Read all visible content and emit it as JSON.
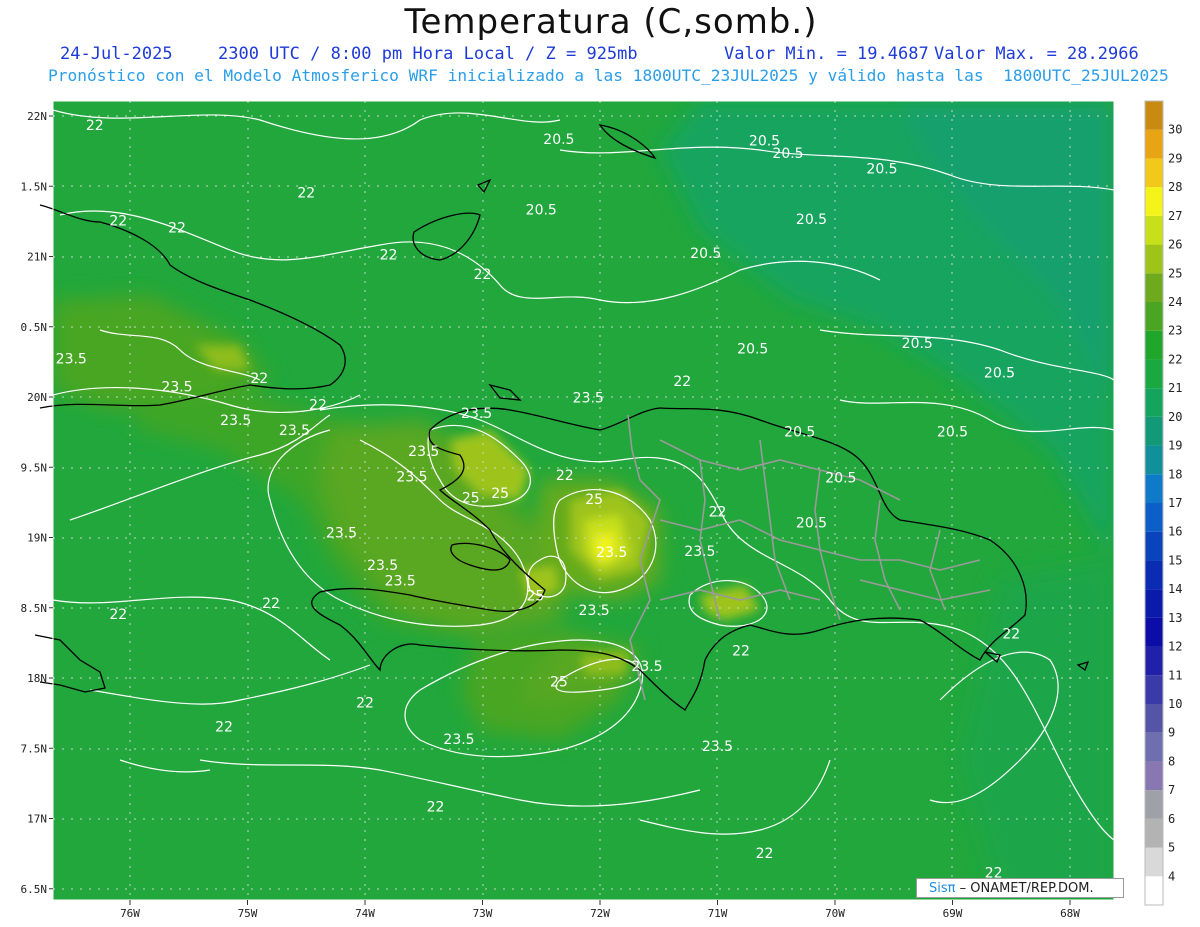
{
  "title": "Temperatura (C,somb.)",
  "subtitle": {
    "date": "24-Jul-2025",
    "time": "2300 UTC / 8:00 pm Hora Local / Z = 925mb",
    "min": "Valor Min. = 19.4687",
    "max": "Valor Max. = 28.2966"
  },
  "forecast_note": "Pronóstico con el Modelo Atmosferico WRF inicializado a las 1800UTC_23JUL2025 y válido hasta las  1800UTC_25JUL2025",
  "credit": {
    "brand": "Sisπ",
    "org": " – ONAMET/REP.DOM."
  },
  "chart_data": {
    "type": "heatmap",
    "variable": "Temperatura (C,somb.)",
    "level": "925mb",
    "value_min": 19.4687,
    "value_max": 28.2966,
    "x_ticks": [
      "76W",
      "75W",
      "74W",
      "73W",
      "72W",
      "71W",
      "70W",
      "69W",
      "68W"
    ],
    "y_ticks": [
      "22N",
      "1.5N",
      "21N",
      "0.5N",
      "20N",
      "9.5N",
      "19N",
      "8.5N",
      "18N",
      "7.5N",
      "17N",
      "6.5N"
    ],
    "colorbar_levels": [
      4,
      5,
      6,
      7,
      8,
      9,
      10,
      11,
      12,
      13,
      14,
      15,
      16,
      17,
      18,
      19,
      20,
      21,
      22,
      23,
      24,
      25,
      26,
      27,
      28,
      29,
      30
    ],
    "colorbar_colors": [
      "#ffffff",
      "#d9d9d9",
      "#b3b3b3",
      "#a0a0a8",
      "#8877b0",
      "#6f6fb0",
      "#5555a8",
      "#3a3aa8",
      "#2020a8",
      "#0c0ca6",
      "#0a1aaa",
      "#0a2cb2",
      "#0a44bc",
      "#0c5ec8",
      "#0f7ac8",
      "#10909a",
      "#129a78",
      "#15a45e",
      "#1aa840",
      "#20a62a",
      "#4aa622",
      "#6faa1e",
      "#9ec41a",
      "#c8e01a",
      "#f4f41a",
      "#f2c81a",
      "#e8a414",
      "#c88a10"
    ],
    "contour_levels": [
      20.5,
      22,
      23.5,
      25
    ],
    "contour_labels": [
      {
        "text": "20.5",
        "lon": -72.35,
        "lat": 21.8
      },
      {
        "text": "20.5",
        "lon": -70.6,
        "lat": 21.79
      },
      {
        "text": "20.5",
        "lon": -70.4,
        "lat": 21.7
      },
      {
        "text": "20.5",
        "lon": -69.6,
        "lat": 21.59
      },
      {
        "text": "20.5",
        "lon": -72.5,
        "lat": 21.3
      },
      {
        "text": "20.5",
        "lon": -70.2,
        "lat": 21.23
      },
      {
        "text": "20.5",
        "lon": -71.1,
        "lat": 20.99
      },
      {
        "text": "20.5",
        "lon": -70.7,
        "lat": 20.31
      },
      {
        "text": "20.5",
        "lon": -69.3,
        "lat": 20.35
      },
      {
        "text": "20.5",
        "lon": -68.6,
        "lat": 20.14
      },
      {
        "text": "20.5",
        "lon": -70.3,
        "lat": 19.72
      },
      {
        "text": "20.5",
        "lon": -69.0,
        "lat": 19.72
      },
      {
        "text": "20.5",
        "lon": -69.95,
        "lat": 19.39
      },
      {
        "text": "20.5",
        "lon": -70.2,
        "lat": 19.07
      },
      {
        "text": "22",
        "lon": -76.3,
        "lat": 21.9
      },
      {
        "text": "22",
        "lon": -76.1,
        "lat": 21.22
      },
      {
        "text": "22",
        "lon": -74.5,
        "lat": 21.42
      },
      {
        "text": "22",
        "lon": -75.6,
        "lat": 21.17
      },
      {
        "text": "22",
        "lon": -73.8,
        "lat": 20.98
      },
      {
        "text": "22",
        "lon": -73.0,
        "lat": 20.84
      },
      {
        "text": "22",
        "lon": -74.9,
        "lat": 20.1
      },
      {
        "text": "22",
        "lon": -74.4,
        "lat": 19.91
      },
      {
        "text": "22",
        "lon": -71.3,
        "lat": 20.08
      },
      {
        "text": "22",
        "lon": -72.3,
        "lat": 19.41
      },
      {
        "text": "22",
        "lon": -71.0,
        "lat": 19.15
      },
      {
        "text": "22",
        "lon": -70.8,
        "lat": 18.16
      },
      {
        "text": "22",
        "lon": -68.5,
        "lat": 18.28
      },
      {
        "text": "22",
        "lon": -76.1,
        "lat": 18.42
      },
      {
        "text": "22",
        "lon": -74.8,
        "lat": 18.5
      },
      {
        "text": "22",
        "lon": -74.0,
        "lat": 17.79
      },
      {
        "text": "22",
        "lon": -75.2,
        "lat": 17.62
      },
      {
        "text": "22",
        "lon": -73.4,
        "lat": 17.05
      },
      {
        "text": "22",
        "lon": -70.6,
        "lat": 16.72
      },
      {
        "text": "22",
        "lon": -68.65,
        "lat": 16.58
      },
      {
        "text": "23.5",
        "lon": -76.5,
        "lat": 20.24
      },
      {
        "text": "23.5",
        "lon": -75.6,
        "lat": 20.04
      },
      {
        "text": "23.5",
        "lon": -75.1,
        "lat": 19.8
      },
      {
        "text": "23.5",
        "lon": -74.6,
        "lat": 19.73
      },
      {
        "text": "23.5",
        "lon": -73.5,
        "lat": 19.58
      },
      {
        "text": "23.5",
        "lon": -73.05,
        "lat": 19.85
      },
      {
        "text": "23.5",
        "lon": -73.6,
        "lat": 19.4
      },
      {
        "text": "23.5",
        "lon": -72.1,
        "lat": 19.96
      },
      {
        "text": "23.5",
        "lon": -74.2,
        "lat": 19.0
      },
      {
        "text": "23.5",
        "lon": -73.85,
        "lat": 18.77
      },
      {
        "text": "23.5",
        "lon": -73.7,
        "lat": 18.66
      },
      {
        "text": "23.5",
        "lon": -72.05,
        "lat": 18.45
      },
      {
        "text": "23.5",
        "lon": -71.6,
        "lat": 18.05
      },
      {
        "text": "23.5",
        "lon": -71.15,
        "lat": 18.87
      },
      {
        "text": "23.5",
        "lon": -71.9,
        "lat": 18.86
      },
      {
        "text": "23.5",
        "lon": -73.2,
        "lat": 17.53
      },
      {
        "text": "23.5",
        "lon": -71.0,
        "lat": 17.48
      },
      {
        "text": "25",
        "lon": -73.1,
        "lat": 19.25
      },
      {
        "text": "25",
        "lon": -72.85,
        "lat": 19.28
      },
      {
        "text": "25",
        "lon": -72.05,
        "lat": 19.24
      },
      {
        "text": "25",
        "lon": -72.55,
        "lat": 18.55
      },
      {
        "text": "25",
        "lon": -72.35,
        "lat": 17.94
      }
    ]
  }
}
